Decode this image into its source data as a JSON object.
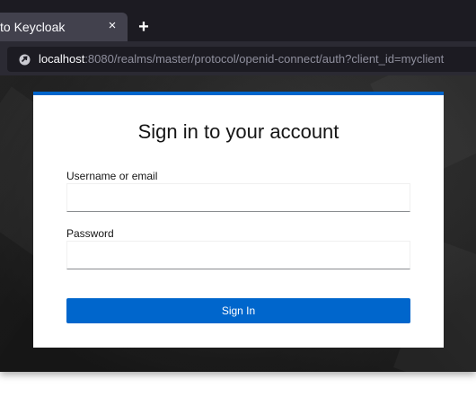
{
  "browser": {
    "tab": {
      "title": "to Keycloak",
      "close_glyph": "×"
    },
    "new_tab_glyph": "+",
    "url": {
      "host": "localhost",
      "rest": ":8080/realms/master/protocol/openid-connect/auth?client_id=myclient"
    }
  },
  "login": {
    "title": "Sign in to your account",
    "username_label": "Username or email",
    "username_value": "",
    "password_label": "Password",
    "password_value": "",
    "submit_label": "Sign In"
  },
  "colors": {
    "accent": "#0066cc",
    "browser_dark": "#1c1b22"
  }
}
